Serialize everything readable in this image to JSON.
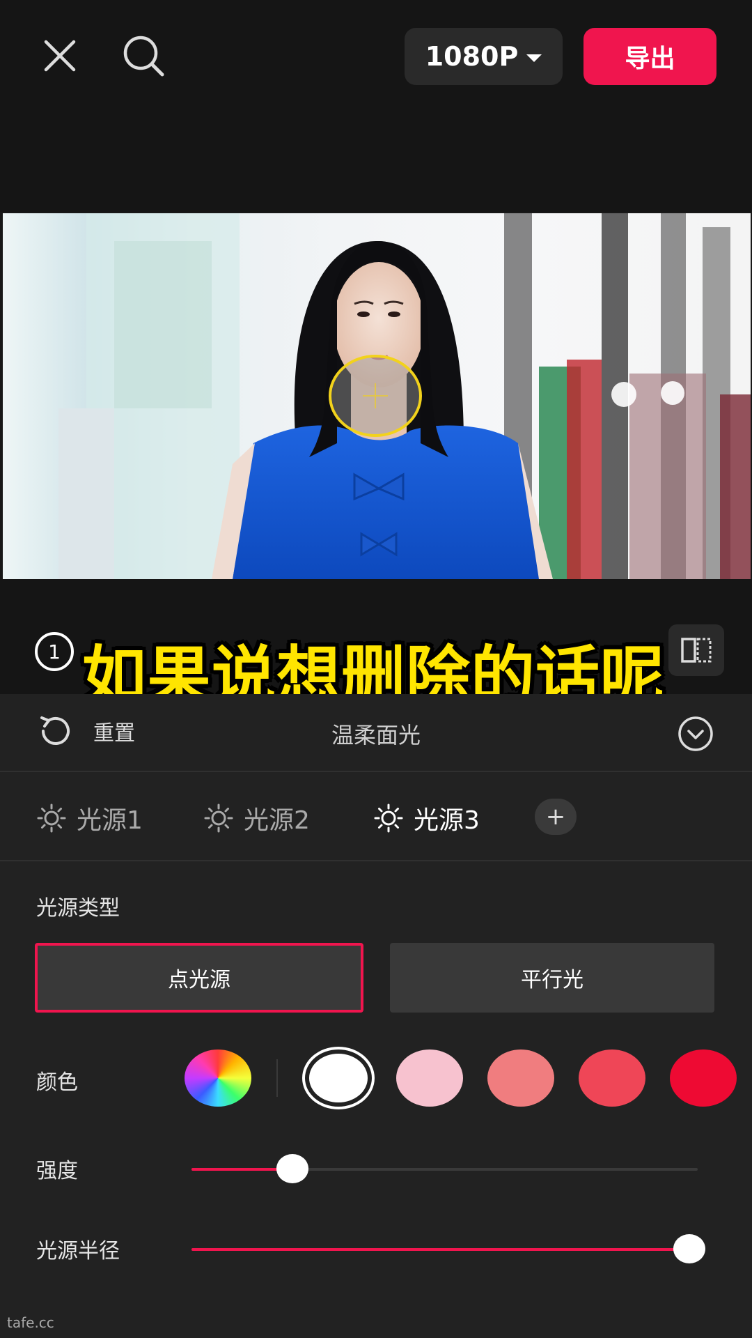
{
  "topbar": {
    "close_icon": "close-icon",
    "search_icon": "search-icon",
    "resolution": "1080P",
    "export_label": "导出"
  },
  "preview": {
    "focus_icon": "light-position-crosshair"
  },
  "overlay": {
    "step": "1",
    "subtitle": "如果说想删除的话呢"
  },
  "panel": {
    "reset_label": "重置",
    "title": "温柔面光",
    "collapse_icon": "chevron-down-icon",
    "light_tabs": [
      {
        "label": "光源1",
        "active": false
      },
      {
        "label": "光源2",
        "active": false
      },
      {
        "label": "光源3",
        "active": true
      }
    ],
    "add_light": "+",
    "light_type": {
      "label": "光源类型",
      "options": [
        "点光源",
        "平行光"
      ],
      "selected": "点光源"
    },
    "color": {
      "label": "颜色",
      "swatches": [
        "#ffffff",
        "#f7c2cf",
        "#f07d7f",
        "#ef4657",
        "#ee0a33"
      ],
      "selected": "#ffffff"
    },
    "intensity": {
      "label": "强度",
      "value": 0.2
    },
    "radius": {
      "label": "光源半径",
      "value": 1.0
    }
  },
  "colors": {
    "accent": "#f0154e",
    "subtitle": "#ffe500",
    "focus_ring": "#f2d21c"
  },
  "watermark": "tafe.cc"
}
